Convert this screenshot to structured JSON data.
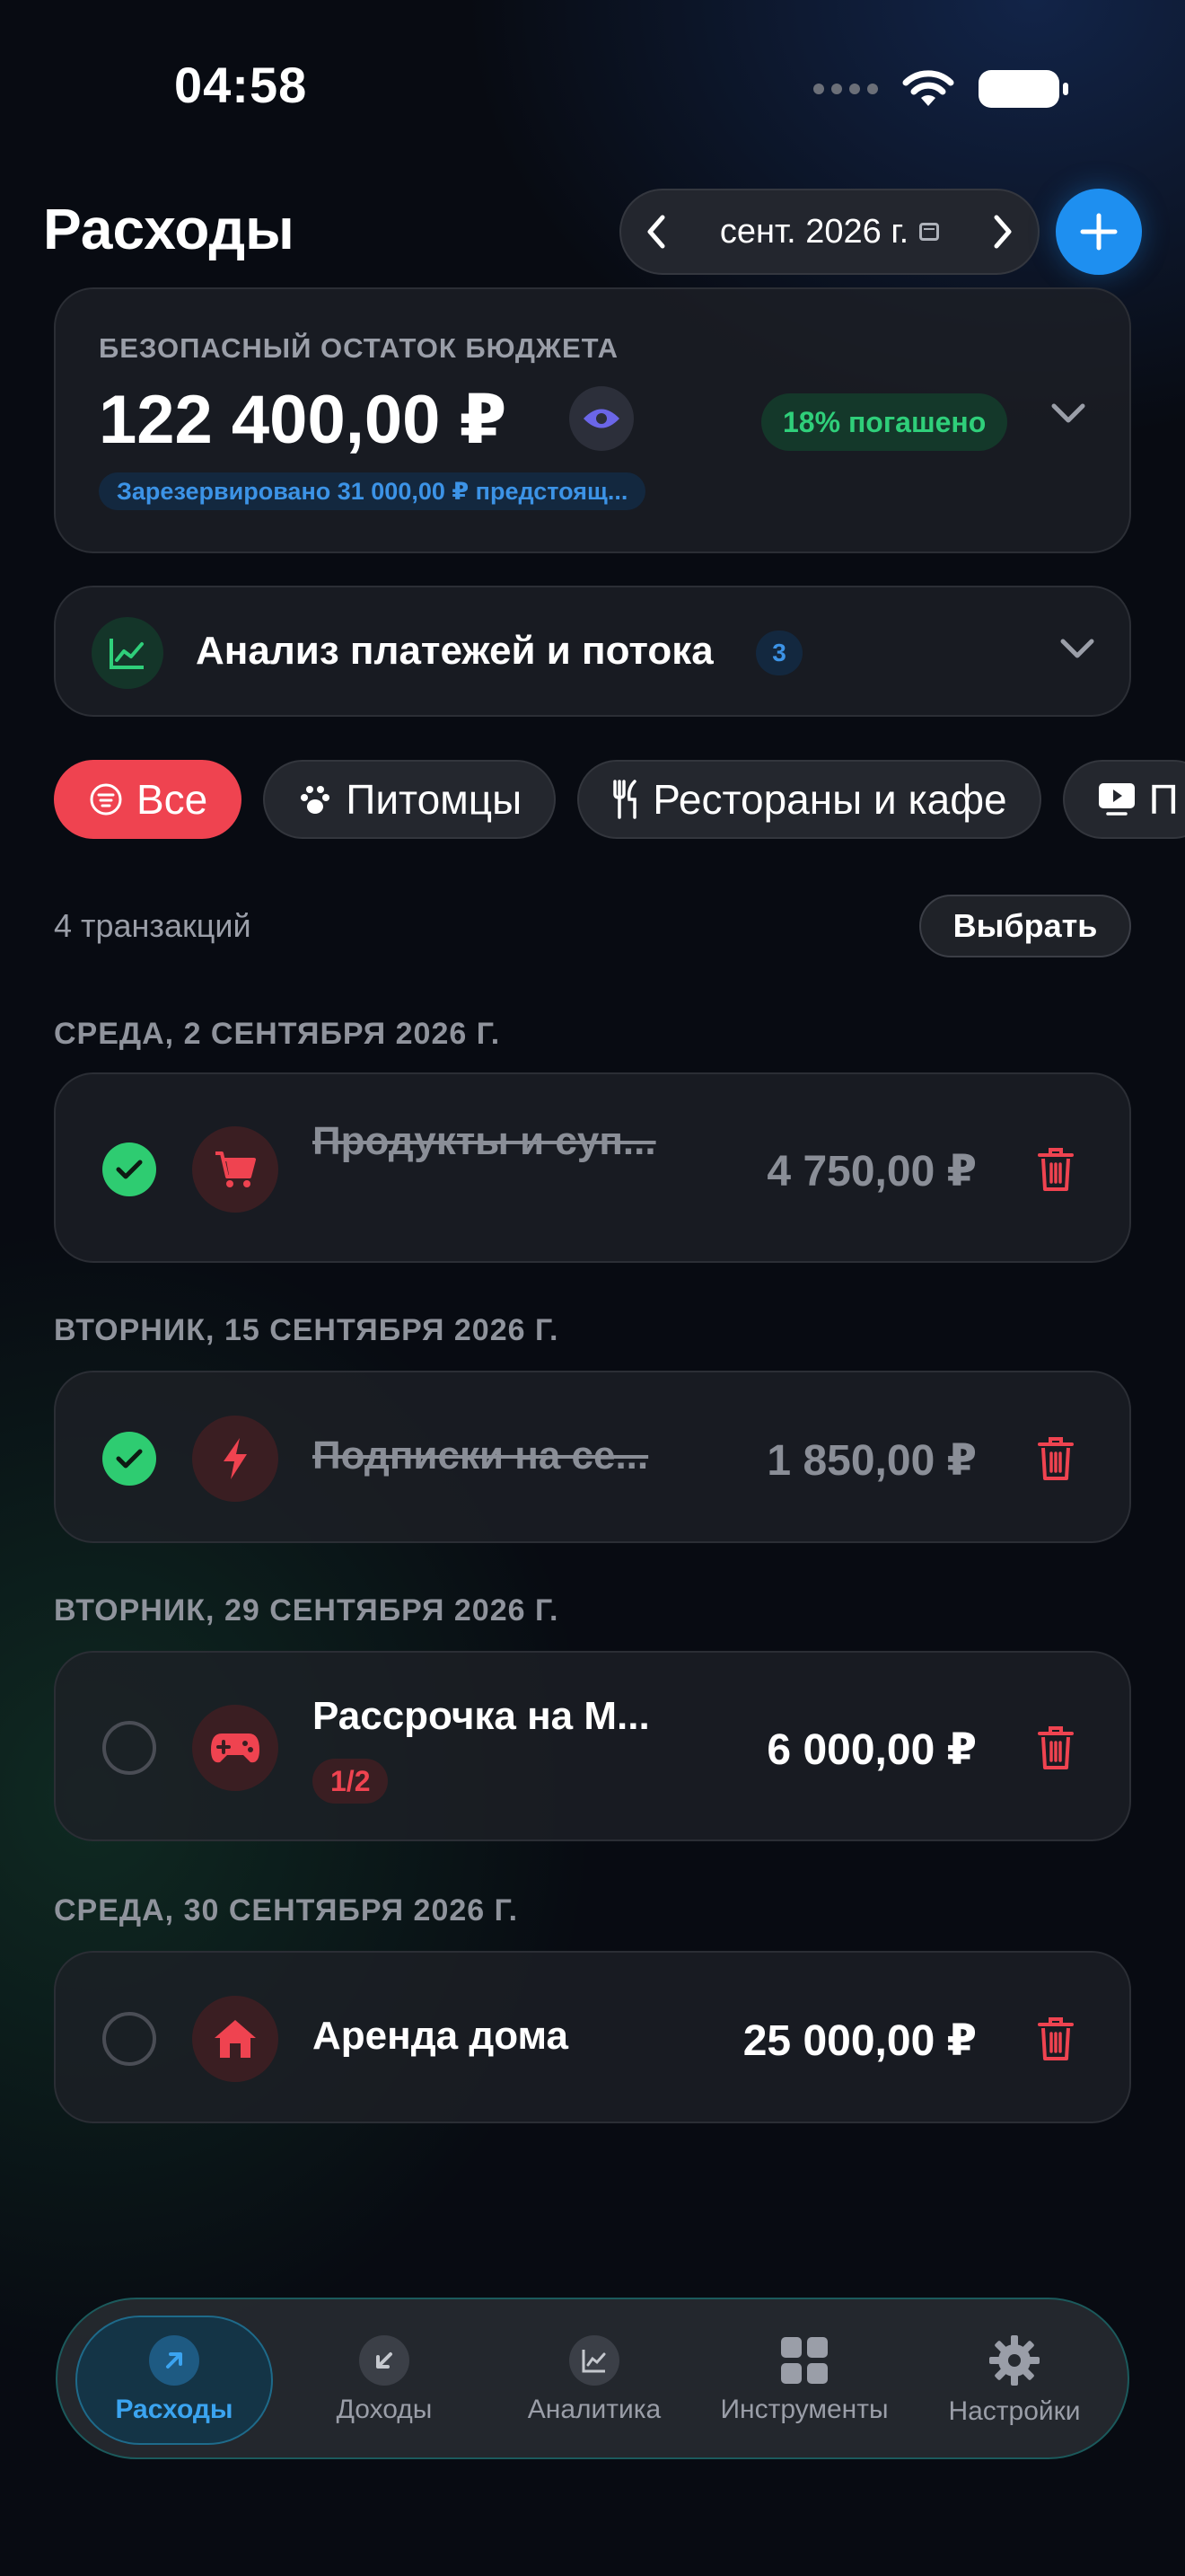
{
  "status_bar": {
    "time": "04:58"
  },
  "header": {
    "title": "Расходы",
    "month": "сент. 2026 г."
  },
  "budget": {
    "caption": "БЕЗОПАСНЫЙ ОСТАТОК БЮДЖЕТА",
    "amount": "122 400,00 ₽",
    "paid_badge": "18% погашено",
    "reserved": "Зарезервировано 31 000,00 ₽ предстоящ..."
  },
  "analysis": {
    "label": "Анализ платежей и потока",
    "badge": "3"
  },
  "filters": [
    {
      "label": "Все",
      "icon": "list-icon"
    },
    {
      "label": "Питомцы",
      "icon": "paw-icon"
    },
    {
      "label": "Рестораны и кафе",
      "icon": "fork-knife-icon"
    },
    {
      "label": "П",
      "icon": "play-icon"
    }
  ],
  "list": {
    "count": "4 транзакций",
    "select_label": "Выбрать"
  },
  "groups": [
    {
      "date": "СРЕДА, 2 СЕНТЯБРЯ 2026 Г.",
      "tx": {
        "name": "Продукты и суп...",
        "amount": "4 750,00 ₽",
        "done": true,
        "icon": "cart-icon"
      }
    },
    {
      "date": "ВТОРНИК, 15 СЕНТЯБРЯ 2026 Г.",
      "tx": {
        "name": "Подписки на се...",
        "amount": "1 850,00 ₽",
        "done": true,
        "icon": "lightning-icon"
      }
    },
    {
      "date": "ВТОРНИК, 29 СЕНТЯБРЯ 2026 Г.",
      "tx": {
        "name": "Рассрочка на М...",
        "amount": "6 000,00 ₽",
        "done": false,
        "icon": "gamepad-icon",
        "installment": "1/2"
      }
    },
    {
      "date": "СРЕДА, 30 СЕНТЯБРЯ 2026 Г.",
      "tx": {
        "name": "Аренда дома",
        "amount": "25 000,00 ₽",
        "done": false,
        "icon": "house-icon"
      }
    }
  ],
  "tabbar": [
    {
      "label": "Расходы",
      "active": true
    },
    {
      "label": "Доходы",
      "active": false
    },
    {
      "label": "Аналитика",
      "active": false
    },
    {
      "label": "Инструменты",
      "active": false
    },
    {
      "label": "Настройки",
      "active": false
    }
  ],
  "colors": {
    "accent_red": "#ef4350",
    "accent_blue": "#1e8ff0",
    "success_green": "#2ecc71"
  }
}
